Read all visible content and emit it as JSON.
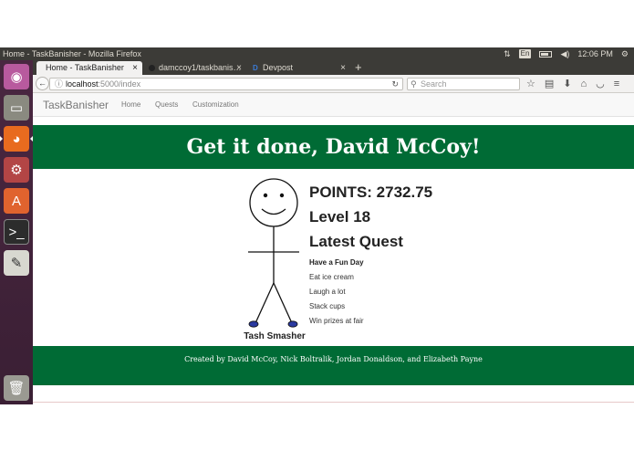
{
  "os": {
    "window_title": "Home - TaskBanisher - Mozilla Firefox",
    "tray": {
      "lang": "En",
      "time": "12:06 PM"
    }
  },
  "browser": {
    "tabs": [
      {
        "label": "Home - TaskBanisher"
      },
      {
        "label": "damccoy1/taskbanis…"
      },
      {
        "label": "Devpost"
      }
    ],
    "url_host": "localhost",
    "url_path": ":5000/index",
    "search_placeholder": "Search"
  },
  "site": {
    "brand": "TaskBanisher",
    "nav": [
      "Home",
      "Quests",
      "Customization"
    ],
    "hero": "Get it done, David McCoy!",
    "character_name": "Tash Smasher",
    "points": "POINTS: 2732.75",
    "level": "Level 18",
    "latest_quest_heading": "Latest Quest",
    "quest": {
      "name": "Have a Fun Day",
      "tasks": [
        "Eat ice cream",
        "Laugh a lot",
        "Stack cups",
        "Win prizes at fair"
      ]
    },
    "footer": "Created by David McCoy, Nick Boltralik, Jordan Donaldson, and Elizabeth Payne"
  },
  "colors": {
    "accent_green": "#006b35",
    "launcher": "#4a2741",
    "panel": "#3c3b37"
  },
  "icons": [
    "ubuntu-icon",
    "files-icon",
    "firefox-icon",
    "settings-icon",
    "software-center-icon",
    "terminal-icon",
    "text-editor-icon",
    "trash-icon"
  ]
}
